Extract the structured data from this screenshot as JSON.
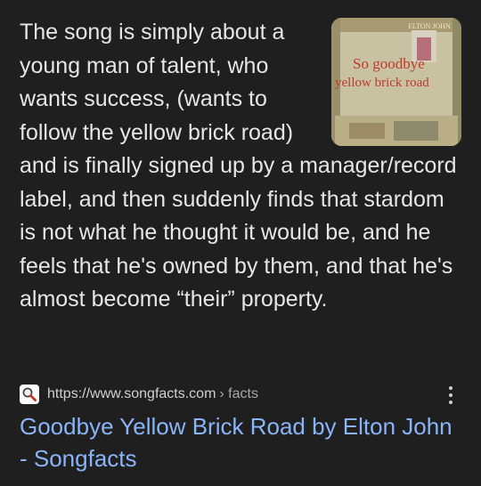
{
  "snippet": {
    "text": "The song is simply about a young man of talent, who wants success, (wants to follow the yellow brick road) and is finally signed up by a manager/record label, and then suddenly finds that stardom is not what he thought it would be, and he feels that he's owned by them, and that he's almost become “their” property.",
    "thumbnail": {
      "line1": "So goodbye",
      "line2": "yellow brick road",
      "top_text": "ELTON JOHN"
    }
  },
  "source": {
    "favicon": "magnifier-icon",
    "url": "https://www.songfacts.com",
    "path": "› facts"
  },
  "result": {
    "title": "Goodbye Yellow Brick Road by Elton John - Songfacts"
  },
  "colors": {
    "background": "#1f1f1f",
    "link": "#8ab4f8",
    "text": "#e6e6e6"
  }
}
